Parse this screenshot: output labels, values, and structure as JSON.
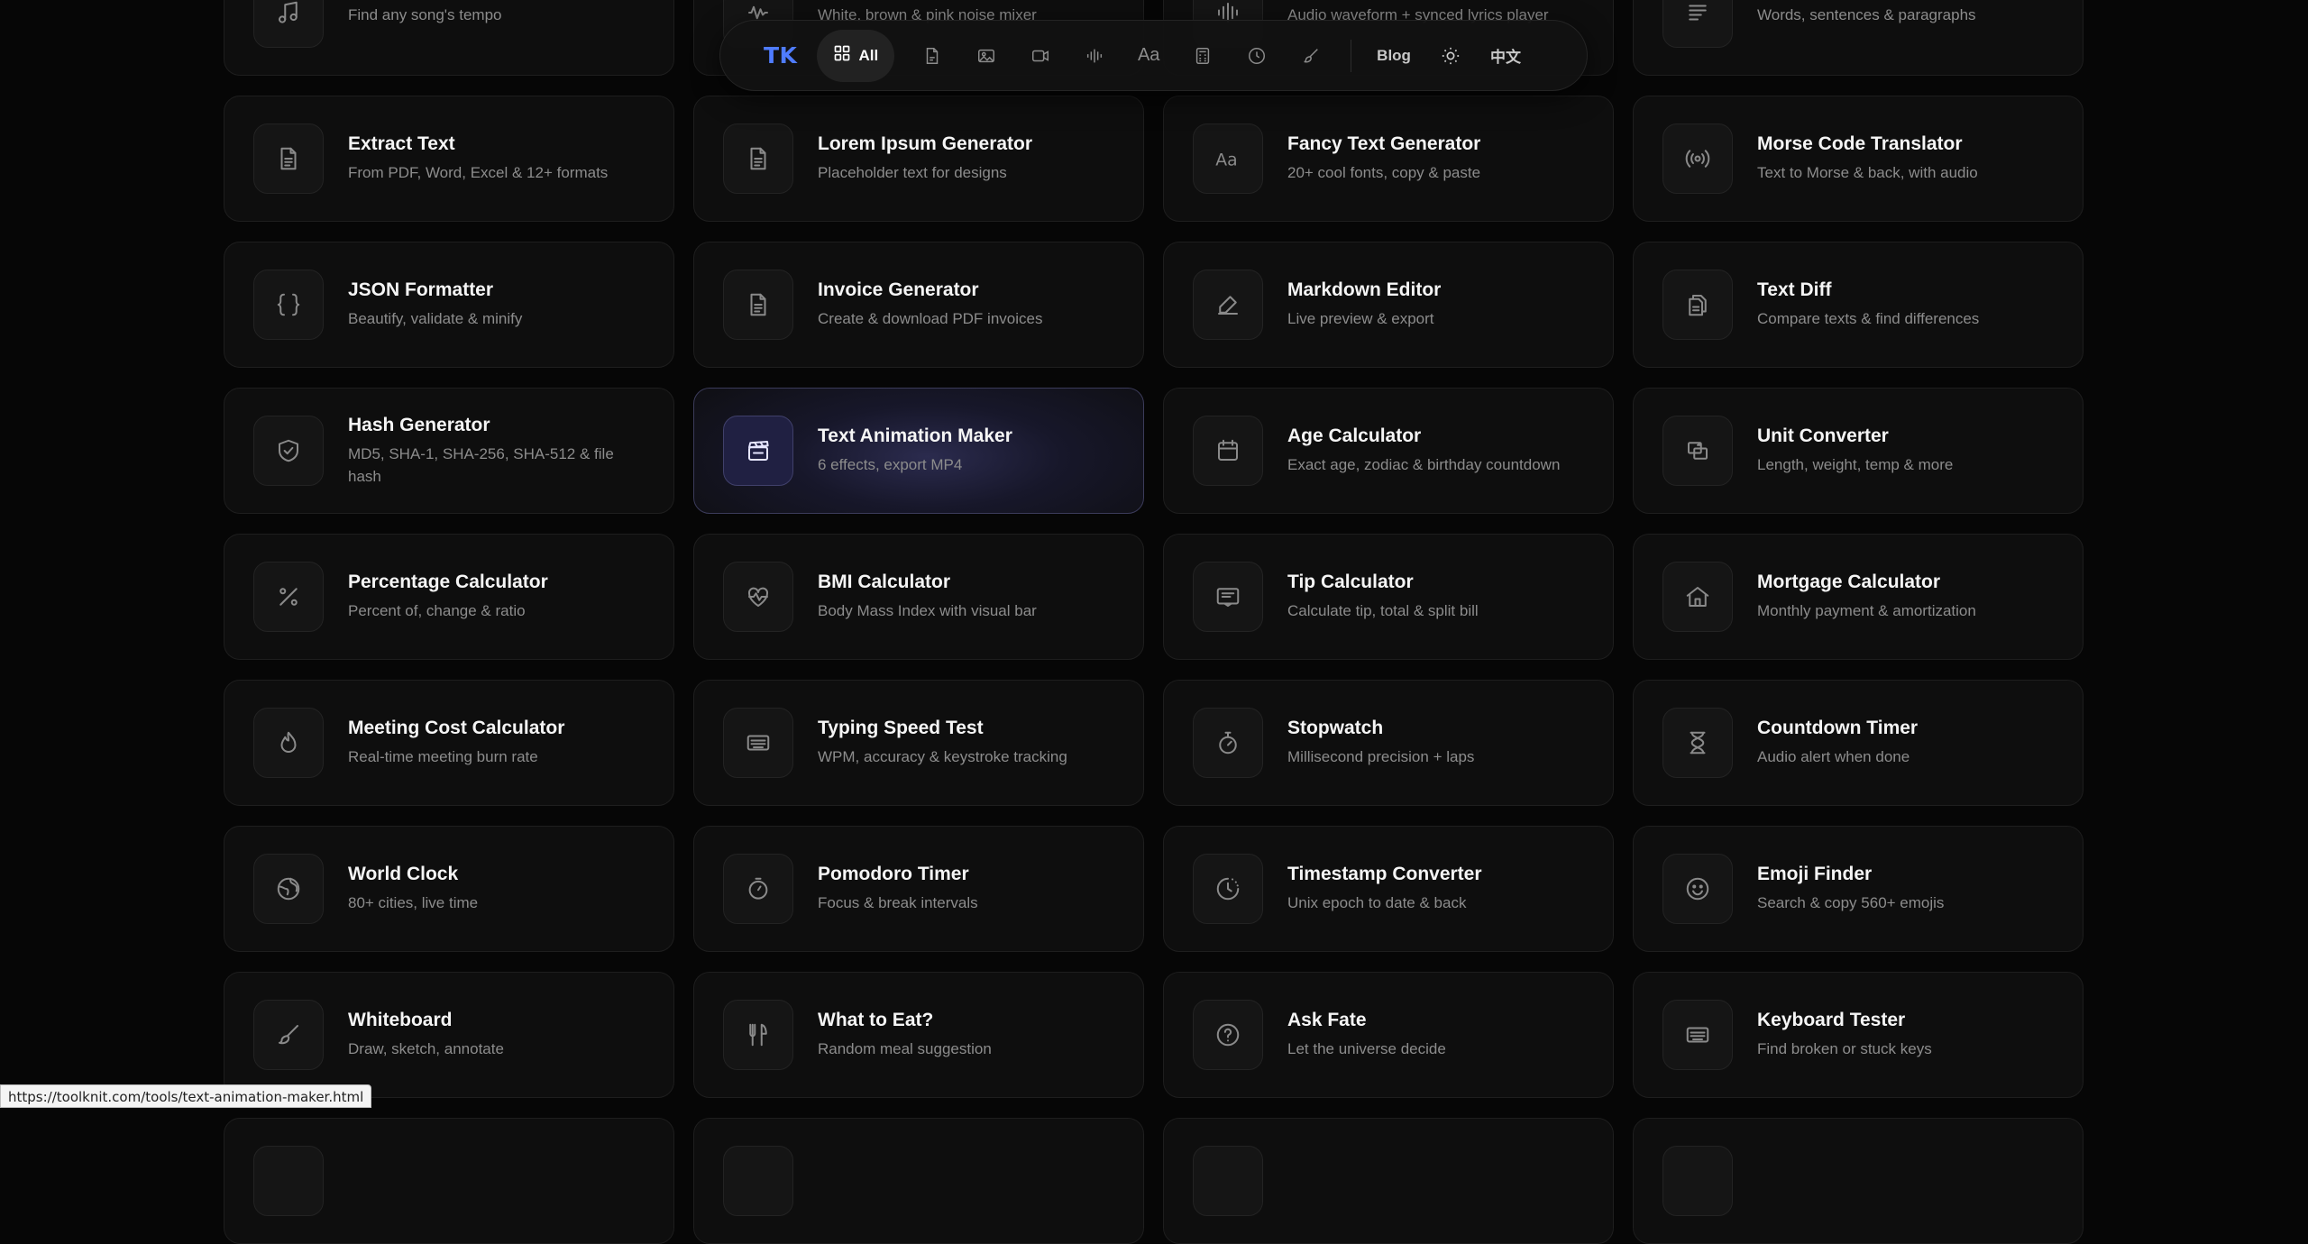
{
  "nav": {
    "logo": "TK",
    "all_label": "All",
    "blog_label": "Blog",
    "lang_label": "中文",
    "text_icon_label": "Aa"
  },
  "cards": [
    {
      "title": "",
      "desc": "Find any song's tempo",
      "icon": "music-icon"
    },
    {
      "title": "",
      "desc": "White, brown & pink noise mixer",
      "icon": "noise-icon"
    },
    {
      "title": "",
      "desc": "Audio waveform + synced lyrics player",
      "icon": "waveform-icon"
    },
    {
      "title": "",
      "desc": "Words, sentences & paragraphs",
      "icon": "counter-icon"
    },
    {
      "title": "Extract Text",
      "desc": "From PDF, Word, Excel & 12+ formats",
      "icon": "document-icon"
    },
    {
      "title": "Lorem Ipsum Generator",
      "desc": "Placeholder text for designs",
      "icon": "document-icon"
    },
    {
      "title": "Fancy Text Generator",
      "desc": "20+ cool fonts, copy & paste",
      "icon": "text-aa-icon"
    },
    {
      "title": "Morse Code Translator",
      "desc": "Text to Morse & back, with audio",
      "icon": "broadcast-icon"
    },
    {
      "title": "JSON Formatter",
      "desc": "Beautify, validate & minify",
      "icon": "braces-icon"
    },
    {
      "title": "Invoice Generator",
      "desc": "Create & download PDF invoices",
      "icon": "document-icon"
    },
    {
      "title": "Markdown Editor",
      "desc": "Live preview & export",
      "icon": "edit-icon"
    },
    {
      "title": "Text Diff",
      "desc": "Compare texts & find differences",
      "icon": "files-icon"
    },
    {
      "title": "Hash Generator",
      "desc": "MD5, SHA-1, SHA-256, SHA-512 & file hash",
      "icon": "shield-check-icon"
    },
    {
      "title": "Text Animation Maker",
      "desc": "6 effects, export MP4",
      "icon": "clapperboard-icon",
      "active": true
    },
    {
      "title": "Age Calculator",
      "desc": "Exact age, zodiac & birthday countdown",
      "icon": "calendar-icon"
    },
    {
      "title": "Unit Converter",
      "desc": "Length, weight, temp & more",
      "icon": "convert-icon"
    },
    {
      "title": "Percentage Calculator",
      "desc": "Percent of, change & ratio",
      "icon": "percent-icon"
    },
    {
      "title": "BMI Calculator",
      "desc": "Body Mass Index with visual bar",
      "icon": "heart-pulse-icon"
    },
    {
      "title": "Tip Calculator",
      "desc": "Calculate tip, total & split bill",
      "icon": "receipt-icon"
    },
    {
      "title": "Mortgage Calculator",
      "desc": "Monthly payment & amortization",
      "icon": "home-icon"
    },
    {
      "title": "Meeting Cost Calculator",
      "desc": "Real-time meeting burn rate",
      "icon": "flame-icon"
    },
    {
      "title": "Typing Speed Test",
      "desc": "WPM, accuracy & keystroke tracking",
      "icon": "keyboard-icon"
    },
    {
      "title": "Stopwatch",
      "desc": "Millisecond precision + laps",
      "icon": "stopwatch-icon"
    },
    {
      "title": "Countdown Timer",
      "desc": "Audio alert when done",
      "icon": "hourglass-icon"
    },
    {
      "title": "World Clock",
      "desc": "80+ cities, live time",
      "icon": "globe-icon"
    },
    {
      "title": "Pomodoro Timer",
      "desc": "Focus & break intervals",
      "icon": "timer-icon"
    },
    {
      "title": "Timestamp Converter",
      "desc": "Unix epoch to date & back",
      "icon": "clock-icon"
    },
    {
      "title": "Emoji Finder",
      "desc": "Search & copy 560+ emojis",
      "icon": "smile-icon"
    },
    {
      "title": "Whiteboard",
      "desc": "Draw, sketch, annotate",
      "icon": "brush-icon"
    },
    {
      "title": "What to Eat?",
      "desc": "Random meal suggestion",
      "icon": "utensils-icon"
    },
    {
      "title": "Ask Fate",
      "desc": "Let the universe decide",
      "icon": "question-icon"
    },
    {
      "title": "Keyboard Tester",
      "desc": "Find broken or stuck keys",
      "icon": "keyboard-icon"
    },
    {
      "title": "",
      "desc": "",
      "icon": ""
    },
    {
      "title": "",
      "desc": "",
      "icon": ""
    },
    {
      "title": "",
      "desc": "",
      "icon": ""
    },
    {
      "title": "",
      "desc": "",
      "icon": ""
    }
  ],
  "status_url": "https://toolknit.com/tools/text-animation-maker.html"
}
